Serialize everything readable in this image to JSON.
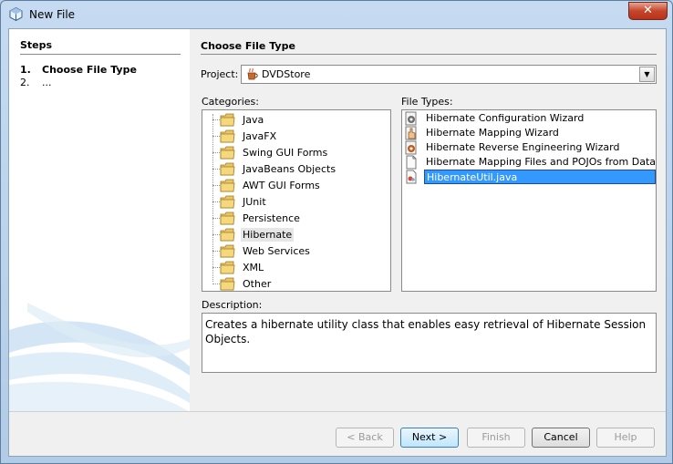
{
  "window": {
    "title": "New File",
    "close_label": "✕"
  },
  "steps": {
    "heading": "Steps",
    "items": [
      {
        "num": "1.",
        "label": "Choose File Type"
      },
      {
        "num": "2.",
        "label": "..."
      }
    ]
  },
  "main": {
    "title": "Choose File Type",
    "project_label": "Project:",
    "project_value": "DVDStore",
    "categories_label": "Categories:",
    "file_types_label": "File Types:",
    "categories": [
      "Java",
      "JavaFX",
      "Swing GUI Forms",
      "JavaBeans Objects",
      "AWT GUI Forms",
      "JUnit",
      "Persistence",
      "Hibernate",
      "Web Services",
      "XML",
      "Other"
    ],
    "selected_category": "Hibernate",
    "file_types": [
      "Hibernate Configuration Wizard",
      "Hibernate Mapping Wizard",
      "Hibernate Reverse Engineering Wizard",
      "Hibernate Mapping Files and POJOs from Database",
      "HibernateUtil.java"
    ],
    "selected_file_type": "HibernateUtil.java",
    "description_label": "Description:",
    "description": "Creates a hibernate utility class that enables easy retrieval of Hibernate Session Objects."
  },
  "buttons": {
    "back": "< Back",
    "next": "Next >",
    "finish": "Finish",
    "cancel": "Cancel",
    "help": "Help"
  },
  "icons": {
    "app": "netbeans-cube-icon",
    "project": "java-cup-icon",
    "category": "folder-icon"
  },
  "colors": {
    "selection": "#3399ff",
    "title_bar": "#c6dbf1",
    "close_button": "#c6452a"
  }
}
